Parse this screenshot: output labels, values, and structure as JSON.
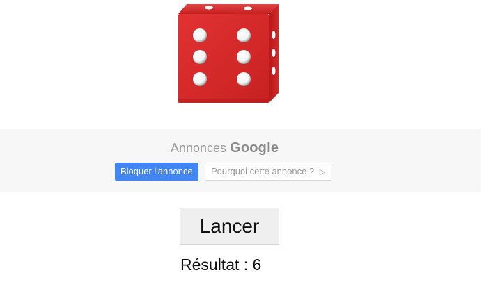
{
  "dice": {
    "face_value": 6,
    "color": "#d92a2a"
  },
  "ad": {
    "title_prefix": "Annonces",
    "title_brand": "Google",
    "block_label": "Bloquer l'annonce",
    "why_label": "Pourquoi cette annonce ?",
    "info_icon": "info-arrow-icon"
  },
  "main": {
    "roll_label": "Lancer",
    "result_label": "Résultat : 6"
  }
}
